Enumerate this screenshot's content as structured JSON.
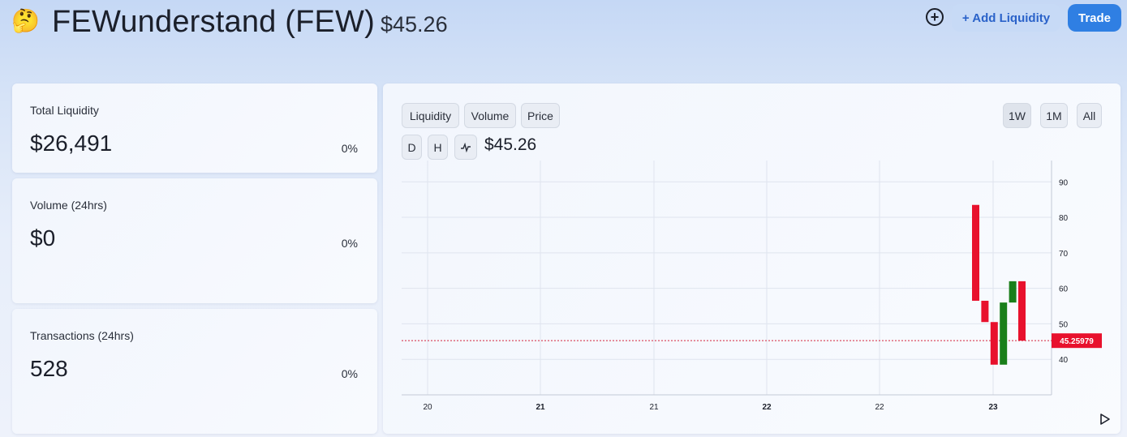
{
  "header": {
    "emoji": "🤔",
    "token_name": "FEWunderstand (FEW)",
    "token_price": "$45.26",
    "plus_icon": "plus-circle-icon",
    "add_liquidity_label": "+ Add Liquidity",
    "trade_label": "Trade"
  },
  "stats": [
    {
      "label": "Total Liquidity",
      "value": "$26,491",
      "change": "0%"
    },
    {
      "label": "Volume (24hrs)",
      "value": "$0",
      "change": "0%"
    },
    {
      "label": "Transactions (24hrs)",
      "value": "528",
      "change": "0%"
    }
  ],
  "chart_controls": {
    "metric_tabs": [
      "Liquidity",
      "Volume",
      "Price"
    ],
    "interval_tabs": [
      "D",
      "H"
    ],
    "line_icon": "line-chart-icon",
    "range_tabs": [
      "1W",
      "1M",
      "All"
    ],
    "active_range": "1W",
    "current_price": "$45.26",
    "play_icon": "play-icon"
  },
  "colors": {
    "up": "#1a7f1a",
    "down": "#e8112d",
    "price_line": "#d4213a",
    "accent": "#2f7fe3"
  },
  "chart_data": {
    "type": "candlestick",
    "title": "",
    "x_ticks": [
      "20",
      "21",
      "21",
      "22",
      "22",
      "23"
    ],
    "x_ticks_bold": [
      false,
      true,
      false,
      true,
      false,
      true
    ],
    "y_ticks": [
      40,
      50,
      60,
      70,
      80,
      90
    ],
    "ylim": [
      30,
      96
    ],
    "last_price_label": "45.25979",
    "last_price": 45.25979,
    "candles": [
      {
        "open": 83.5,
        "close": 56.5,
        "dir": "down"
      },
      {
        "open": 56.5,
        "close": 50.5,
        "dir": "down"
      },
      {
        "open": 50.5,
        "close": 38.5,
        "dir": "down"
      },
      {
        "open": 38.5,
        "close": 56.0,
        "dir": "up"
      },
      {
        "open": 56.0,
        "close": 62.0,
        "dir": "up"
      },
      {
        "open": 62.0,
        "close": 45.26,
        "dir": "down"
      }
    ],
    "grid": true
  }
}
